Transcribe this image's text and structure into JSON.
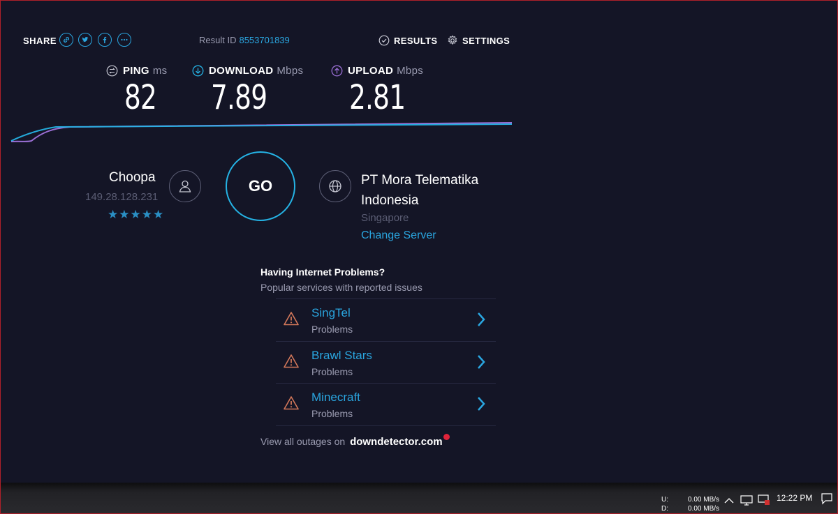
{
  "share": {
    "label": "SHARE",
    "icons": [
      "link-icon",
      "twitter-icon",
      "facebook-icon",
      "more-icon"
    ]
  },
  "result": {
    "label": "Result ID",
    "id": "8553701839"
  },
  "nav": {
    "results": "RESULTS",
    "settings": "SETTINGS"
  },
  "metrics": {
    "ping": {
      "label": "PING",
      "unit": "ms",
      "value": "82"
    },
    "download": {
      "label": "DOWNLOAD",
      "unit": "Mbps",
      "value": "7.89"
    },
    "upload": {
      "label": "UPLOAD",
      "unit": "Mbps",
      "value": "2.81"
    }
  },
  "isp": {
    "name": "Choopa",
    "ip": "149.28.128.231",
    "stars": "★★★★★",
    "rating": 5
  },
  "go_label": "GO",
  "server": {
    "name": "PT Mora Telematika Indonesia",
    "location": "Singapore",
    "change": "Change Server"
  },
  "problems": {
    "title": "Having Internet Problems?",
    "subtitle": "Popular services with reported issues",
    "items": [
      {
        "name": "SingTel",
        "status": "Problems"
      },
      {
        "name": "Brawl Stars",
        "status": "Problems"
      },
      {
        "name": "Minecraft",
        "status": "Problems"
      }
    ],
    "outages_prefix": "View all outages on",
    "outages_brand": "downdetector.com"
  },
  "taskbar": {
    "upload_label": "U:",
    "upload_value": "0.00 MB/s",
    "download_label": "D:",
    "download_value": "0.00 MB/s",
    "time": "12:22 PM"
  },
  "colors": {
    "accent": "#2aa6e0",
    "download_line": "#25b3e5",
    "upload_line": "#9b6fd6",
    "background": "#141526",
    "warning": "#d4785a"
  }
}
